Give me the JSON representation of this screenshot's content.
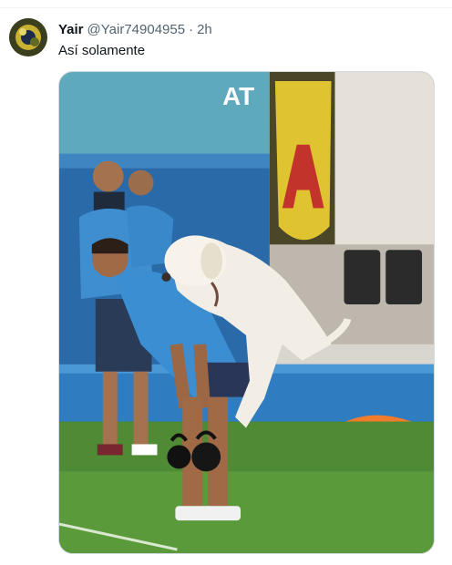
{
  "tweet": {
    "author": {
      "display_name": "Yair",
      "handle": "@Yair74904955"
    },
    "separator": "·",
    "time": "2h",
    "text": "Así solamente",
    "media": {
      "banner_text": "AT"
    }
  }
}
